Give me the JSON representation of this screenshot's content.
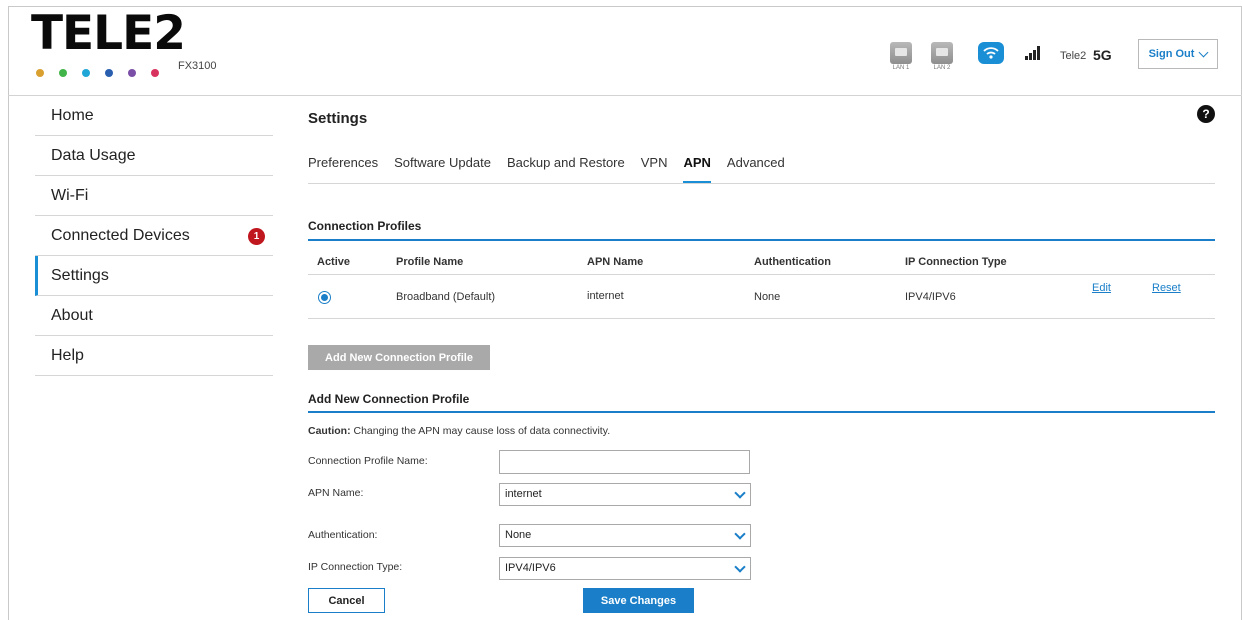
{
  "brand": {
    "logo": "TELE2",
    "model": "FX3100",
    "dot_colors": [
      "#d9a030",
      "#41b54a",
      "#1fa6d6",
      "#2a5fb0",
      "#7b4fa7",
      "#d8335f"
    ]
  },
  "header": {
    "lan1_label": "LAN 1",
    "lan2_label": "LAN 2",
    "carrier": "Tele2",
    "network": "5G",
    "sign_out": "Sign Out"
  },
  "sidebar": {
    "items": [
      {
        "label": "Home"
      },
      {
        "label": "Data Usage"
      },
      {
        "label": "Wi-Fi"
      },
      {
        "label": "Connected Devices",
        "badge": "1"
      },
      {
        "label": "Settings",
        "active": true
      },
      {
        "label": "About"
      },
      {
        "label": "Help"
      }
    ]
  },
  "main": {
    "title": "Settings",
    "tabs": [
      {
        "label": "Preferences"
      },
      {
        "label": "Software Update"
      },
      {
        "label": "Backup and Restore"
      },
      {
        "label": "VPN"
      },
      {
        "label": "APN",
        "active": true
      },
      {
        "label": "Advanced"
      }
    ],
    "connection_profiles": {
      "title": "Connection Profiles",
      "columns": [
        "Active",
        "Profile Name",
        "APN Name",
        "Authentication",
        "IP Connection Type"
      ],
      "rows": [
        {
          "active": true,
          "profile_name": "Broadband (Default)",
          "apn_name": "internet",
          "authentication": "None",
          "ip_type": "IPV4/IPV6",
          "edit": "Edit",
          "reset": "Reset"
        }
      ],
      "add_button": "Add New Connection Profile"
    },
    "add_profile": {
      "title": "Add New Connection Profile",
      "caution_label": "Caution:",
      "caution_text": " Changing the APN may cause loss of data connectivity.",
      "fields": {
        "profile_name_label": "Connection Profile Name:",
        "profile_name_value": "",
        "apn_label": "APN Name:",
        "apn_value": "internet",
        "auth_label": "Authentication:",
        "auth_value": "None",
        "ip_label": "IP Connection Type:",
        "ip_value": "IPV4/IPV6"
      },
      "cancel": "Cancel",
      "save": "Save Changes"
    }
  },
  "colors": {
    "accent": "#1a7fc8",
    "badge": "#c0161e",
    "disabled_button": "#a9a9a9"
  }
}
